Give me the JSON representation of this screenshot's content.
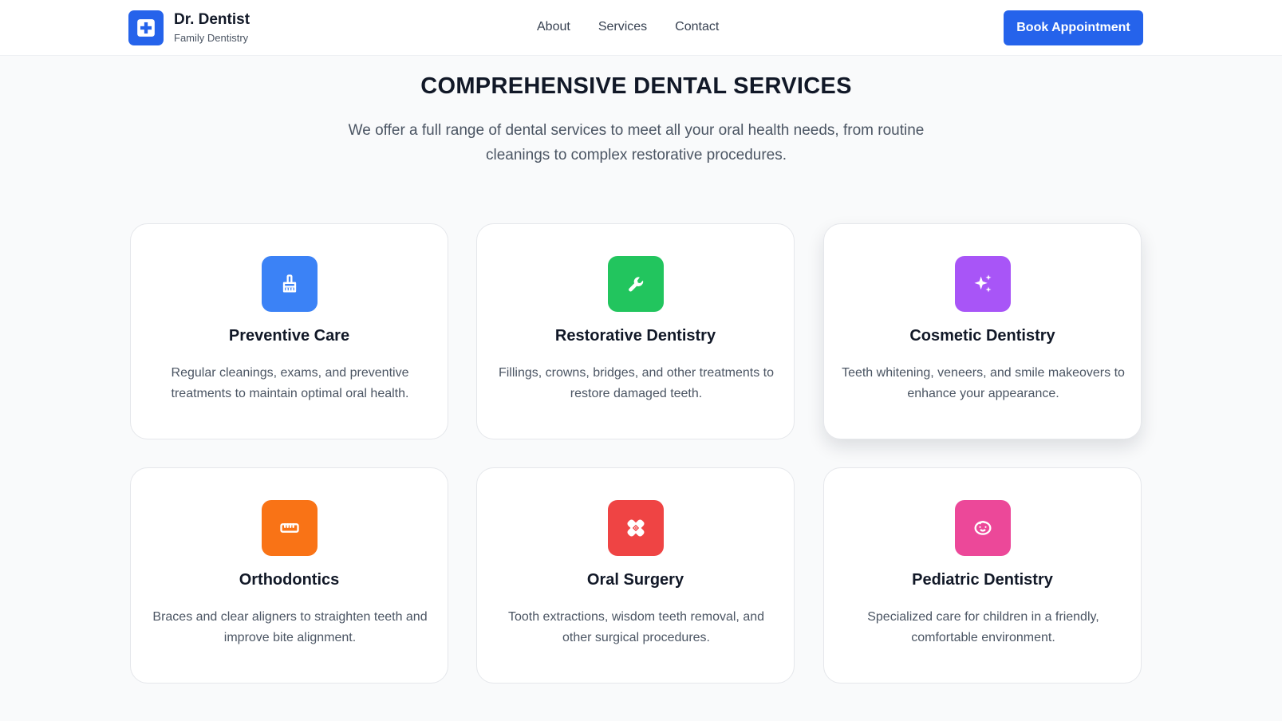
{
  "header": {
    "brand_name": "Dr. Dentist",
    "brand_tagline": "Family Dentistry",
    "brand_icon": "medical-cross-icon",
    "nav": [
      {
        "label": "About"
      },
      {
        "label": "Services"
      },
      {
        "label": "Contact"
      }
    ],
    "cta_label": "Book Appointment"
  },
  "section": {
    "title": "COMPREHENSIVE DENTAL SERVICES",
    "subtitle": "We offer a full range of dental services to meet all your oral health needs, from routine cleanings to complex restorative procedures."
  },
  "services": [
    {
      "title": "Preventive Care",
      "description": "Regular cleanings, exams, and preventive treatments to maintain optimal oral health.",
      "icon": "brush-icon",
      "color": "#3b82f6"
    },
    {
      "title": "Restorative Dentistry",
      "description": "Fillings, crowns, bridges, and other treatments to restore damaged teeth.",
      "icon": "wrench-icon",
      "color": "#22c55e"
    },
    {
      "title": "Cosmetic Dentistry",
      "description": "Teeth whitening, veneers, and smile makeovers to enhance your appearance.",
      "icon": "sparkles-icon",
      "color": "#a855f7"
    },
    {
      "title": "Orthodontics",
      "description": "Braces and clear aligners to straighten teeth and improve bite alignment.",
      "icon": "ruler-icon",
      "color": "#f97316"
    },
    {
      "title": "Oral Surgery",
      "description": "Tooth extractions, wisdom teeth removal, and other surgical procedures.",
      "icon": "bandage-icon",
      "color": "#ef4444"
    },
    {
      "title": "Pediatric Dentistry",
      "description": "Specialized care for children in a friendly, comfortable environment.",
      "icon": "baby-face-icon",
      "color": "#ec4899"
    }
  ],
  "colors": {
    "primary": "#2563eb",
    "background": "#f9fafb"
  }
}
